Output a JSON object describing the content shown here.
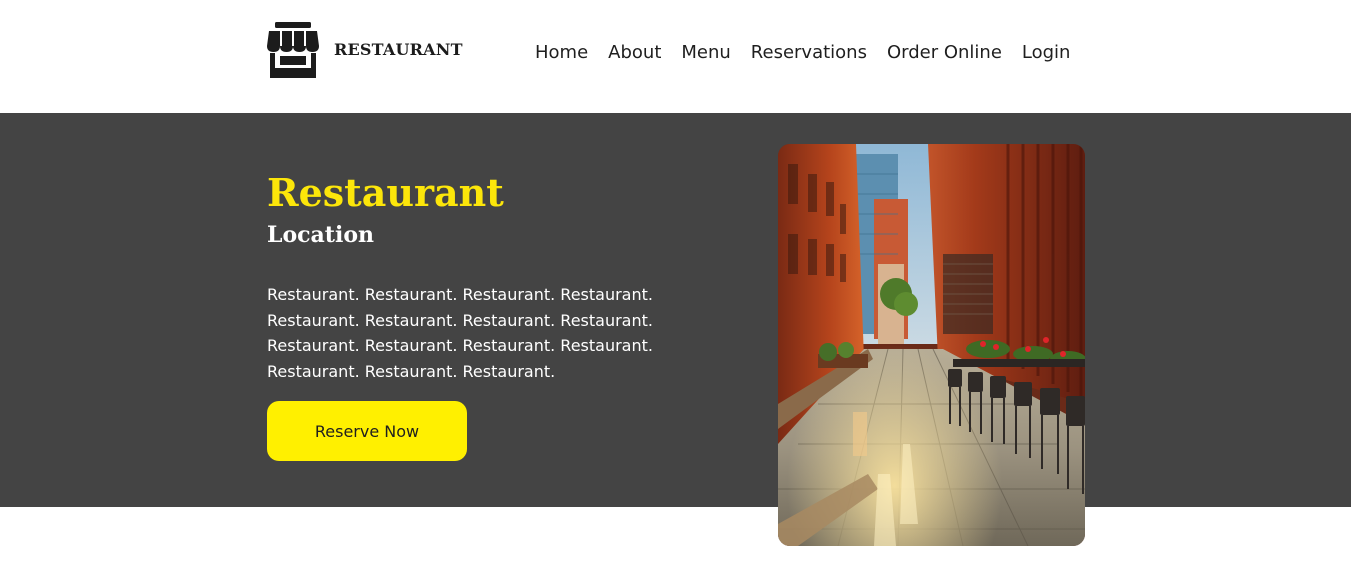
{
  "brand": {
    "name": "RESTAURANT",
    "icon": "storefront-icon"
  },
  "nav": {
    "items": [
      "Home",
      "About",
      "Menu",
      "Reservations",
      "Order Online",
      "Login"
    ]
  },
  "hero": {
    "title": "Restaurant",
    "subtitle": "Location",
    "description": "Restaurant. Restaurant. Restaurant. Restaurant. Restaurant. Restaurant. Restaurant. Restaurant. Restaurant. Restaurant. Restaurant. Restaurant. Restaurant. Restaurant. Restaurant.",
    "cta_label": "Reserve Now",
    "image": "restaurant-alley-photo"
  },
  "colors": {
    "hero_bg": "#444444",
    "accent": "#fce60a",
    "button": "#fff000",
    "text_dark": "#1f1f1f"
  }
}
